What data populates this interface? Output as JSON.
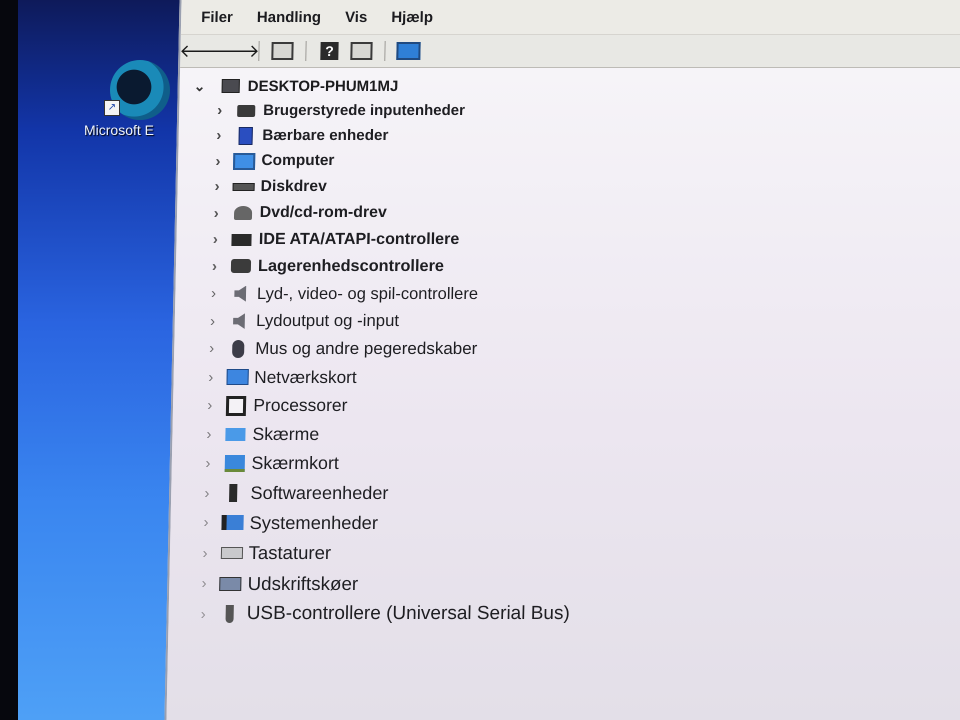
{
  "desktop": {
    "icon_label": "Microsoft E"
  },
  "menubar": {
    "items": [
      "Filer",
      "Handling",
      "Vis",
      "Hjælp"
    ]
  },
  "toolbar": {
    "buttons": [
      "back-icon",
      "forward-icon",
      "properties-icon",
      "help-icon",
      "view-icon",
      "monitor-icon"
    ]
  },
  "tree": {
    "root": "DESKTOP-PHUM1MJ",
    "items": [
      {
        "label": "Brugerstyrede inputenheder",
        "icon": "hid-icon"
      },
      {
        "label": "Bærbare enheder",
        "icon": "portable-device-icon"
      },
      {
        "label": "Computer",
        "icon": "computer-icon"
      },
      {
        "label": "Diskdrev",
        "icon": "disk-drive-icon"
      },
      {
        "label": "Dvd/cd-rom-drev",
        "icon": "dvd-drive-icon"
      },
      {
        "label": "IDE ATA/ATAPI-controllere",
        "icon": "ide-controller-icon"
      },
      {
        "label": "Lagerenhedscontrollere",
        "icon": "storage-controller-icon"
      },
      {
        "label": "Lyd-, video- og spil-controllere",
        "icon": "speaker-icon"
      },
      {
        "label": "Lydoutput og -input",
        "icon": "speaker-icon"
      },
      {
        "label": "Mus og andre pegeredskaber",
        "icon": "mouse-icon"
      },
      {
        "label": "Netværkskort",
        "icon": "network-adapter-icon"
      },
      {
        "label": "Processorer",
        "icon": "processor-icon"
      },
      {
        "label": "Skærme",
        "icon": "monitor-icon"
      },
      {
        "label": "Skærmkort",
        "icon": "display-adapter-icon"
      },
      {
        "label": "Softwareenheder",
        "icon": "software-device-icon"
      },
      {
        "label": "Systemenheder",
        "icon": "system-device-icon"
      },
      {
        "label": "Tastaturer",
        "icon": "keyboard-icon"
      },
      {
        "label": "Udskriftskøer",
        "icon": "printer-icon"
      },
      {
        "label": "USB-controllere (Universal Serial Bus)",
        "icon": "usb-icon"
      }
    ]
  }
}
